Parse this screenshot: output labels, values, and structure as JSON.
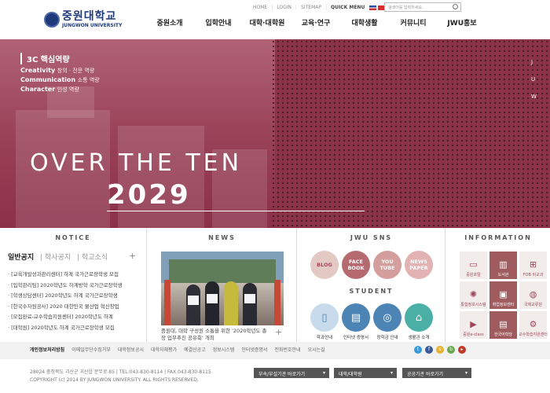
{
  "logo": {
    "korean": "중원대학교",
    "english": "JUNGWON UNIVERSITY"
  },
  "util_links": [
    "HOME",
    "LOGIN",
    "SITEMAP",
    "QUICK MENU"
  ],
  "search": {
    "placeholder": "검색어를 입력하세요."
  },
  "gnb": [
    "중원소개",
    "입학안내",
    "대학·대학원",
    "교육·연구",
    "대학생활",
    "커뮤니티",
    "JWU홍보"
  ],
  "hero": {
    "caption_title": "3C 핵심역량",
    "caption_lines": [
      {
        "en": "Creativity",
        "kr": "창의 · 전문 역량"
      },
      {
        "en": "Communication",
        "kr": "소통 역량"
      },
      {
        "en": "Character",
        "kr": "인성 역량"
      }
    ],
    "headline": "OVER THE TEN",
    "year": "2029",
    "side_letters": [
      "J",
      "U",
      "W"
    ]
  },
  "notice": {
    "title": "NOTICE",
    "tabs": [
      "일반공지",
      "학사공지",
      "학교소식"
    ],
    "items": [
      "· [교육개발성과관리센터] 하계 국가근로장학생 모집",
      "· [입학관리팀] 2020학년도 하계방학 국가근로장학생",
      "· [학생상담센터] 2020학년도 하계 국가근로장학생",
      "· [한국수자원공사] 2020 대한민국 물산업 혁신창업",
      "· [모집완료-교수학습지원센터] 2020학년도 하계",
      "· [대학원] 2020학년도 하계 국가근로장학생 모집"
    ]
  },
  "news": {
    "title": "NEWS",
    "caption": "중원대, 대학 구성원 소통을 위한 '2020학년도 총장 업무추진 공유회' 개최"
  },
  "sns": {
    "title": "JWU SNS",
    "items": [
      {
        "label": "BLOG",
        "color": "#e3c8c4"
      },
      {
        "label": "FACE BOOK",
        "color": "#b46a6f"
      },
      {
        "label": "YOU TUBE",
        "color": "#d39e9c"
      },
      {
        "label": "NEWS PAPER",
        "color": "#e3b2b3"
      }
    ]
  },
  "student": {
    "title": "STUDENT",
    "items": [
      {
        "label": "학과안내",
        "icon": "book-icon",
        "color": "#c7dbec"
      },
      {
        "label": "인터넷 증명서",
        "icon": "document-icon",
        "color": "#4d84b6"
      },
      {
        "label": "장학금 안내",
        "icon": "medal-icon",
        "color": "#4d84b6"
      },
      {
        "label": "생활관 소개",
        "icon": "building-icon",
        "color": "#4ab0a6"
      }
    ]
  },
  "information": {
    "title": "INFORMATION",
    "items": [
      {
        "label": "중원포탈",
        "icon": "monitor-icon",
        "style": "light"
      },
      {
        "label": "도서관",
        "icon": "library-icon",
        "style": "dark"
      },
      {
        "label": "FOB 비교과",
        "icon": "gift-icon",
        "style": "light"
      },
      {
        "label": "통합정보시스템",
        "icon": "atom-icon",
        "style": "light"
      },
      {
        "label": "취업정보센터",
        "icon": "briefcase-icon",
        "style": "dark"
      },
      {
        "label": "국제교류원",
        "icon": "globe-icon",
        "style": "light"
      },
      {
        "label": "중원e-class",
        "icon": "tv-icon",
        "style": "light"
      },
      {
        "label": "한국어학당",
        "icon": "book-stack-icon",
        "style": "dark"
      },
      {
        "label": "교수학습지원센터",
        "icon": "gear-icon",
        "style": "light"
      }
    ]
  },
  "footer_links": [
    "개인정보처리방침",
    "이메일무단수집거부",
    "대학정보공시",
    "대학자체평가",
    "예결산공고",
    "정보시스템",
    "인터넷증명서",
    "전화번호안내",
    "오시는길"
  ],
  "footer": {
    "address": "28024 충청북도 괴산군 괴산읍 문무로 85  |  TEL:043-830-8114  |  FAX:043-830-8115",
    "copyright": "COPYRIGHT (c) 2014 BY JUNGWON UNIVERSITY. ALL RIGHTS RESERVED.",
    "selects": [
      "부속/부설기관 바로가기",
      "대학/대학원",
      "공공기관 바로가기"
    ]
  }
}
